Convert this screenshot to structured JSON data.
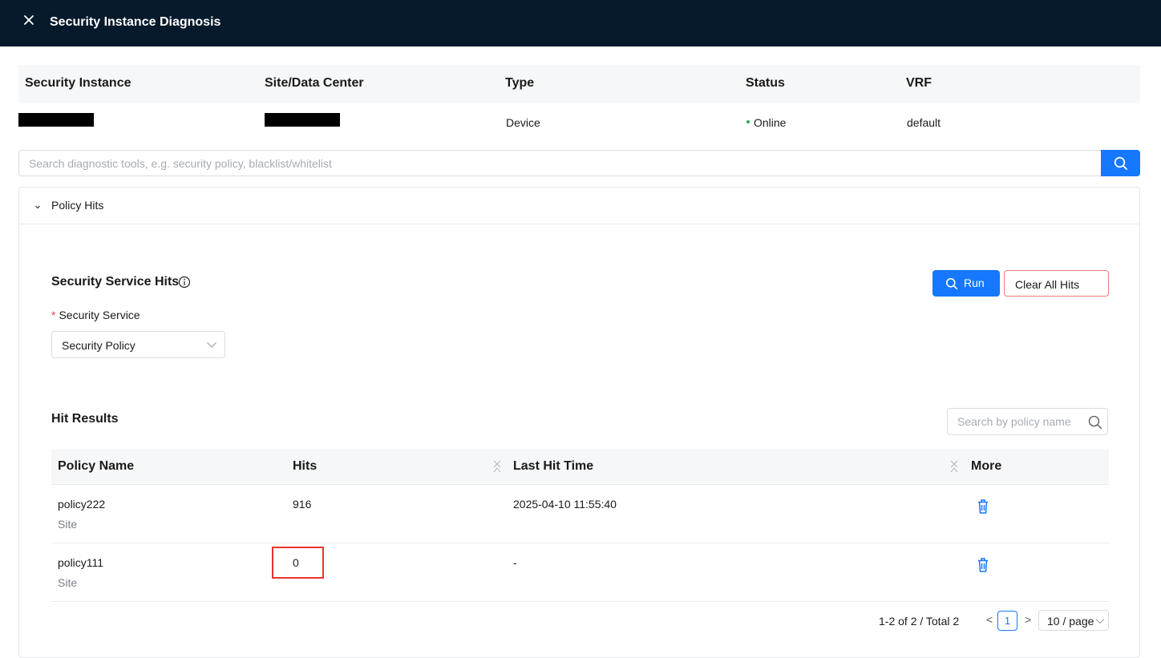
{
  "header": {
    "title": "Security Instance Diagnosis"
  },
  "instance_table": {
    "columns": [
      "Security Instance",
      "Site/Data Center",
      "Type",
      "Status",
      "VRF"
    ],
    "row": {
      "type": "Device",
      "status": "Online",
      "vrf": "default"
    }
  },
  "search": {
    "placeholder": "Search diagnostic tools, e.g. security policy, blacklist/whitelist"
  },
  "panel": {
    "title": "Policy Hits",
    "section_title": "Security Service Hits",
    "run_label": "Run",
    "clear_label": "Clear All Hits",
    "field_label": "Security Service",
    "field_required_mark": "*",
    "field_value": "Security Policy",
    "results_title": "Hit Results",
    "results_search_placeholder": "Search by policy name"
  },
  "results_table": {
    "columns": [
      "Policy Name",
      "Hits",
      "Last Hit Time",
      "More"
    ],
    "rows": [
      {
        "name": "policy222",
        "scope": "Site",
        "hits": "916",
        "last_hit": "2025-04-10 11:55:40"
      },
      {
        "name": "policy111",
        "scope": "Site",
        "hits": "0",
        "last_hit": "-"
      }
    ]
  },
  "pagination": {
    "summary": "1-2 of 2 / Total 2",
    "prev": "<",
    "current_page": "1",
    "next": ">",
    "page_size": "10 / page"
  },
  "colors": {
    "header_bg": "#071a2c",
    "primary": "#1677ff",
    "danger_border": "#f07a7a",
    "highlight": "#e8332b",
    "online": "#2ca84a"
  },
  "icons": [
    "close-icon",
    "search-icon",
    "chevron-down-icon",
    "info-icon",
    "sort-icon",
    "delete-icon"
  ]
}
